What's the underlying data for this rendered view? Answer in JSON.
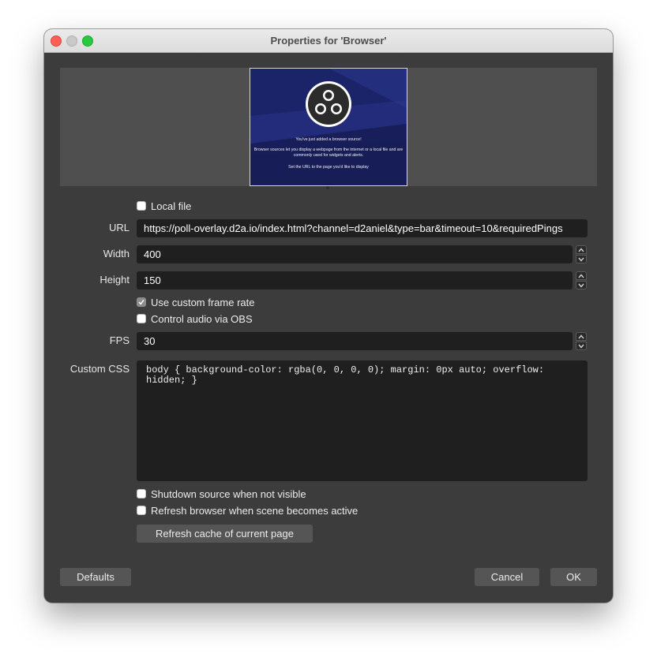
{
  "window": {
    "title": "Properties for 'Browser'"
  },
  "preview": {
    "line1": "You've just added a browser source!",
    "line2": "Browser sources let you display a webpage from the internet or a local file and are commonly used for widgets and alerts.",
    "line3": "Set the URL to the page you'd like to display"
  },
  "form": {
    "local_file": {
      "label": "Local file",
      "checked": false
    },
    "url": {
      "label": "URL",
      "value": "https://poll-overlay.d2a.io/index.html?channel=d2aniel&type=bar&timeout=10&requiredPings"
    },
    "width": {
      "label": "Width",
      "value": "400"
    },
    "height": {
      "label": "Height",
      "value": "150"
    },
    "custom_frame_rate": {
      "label": "Use custom frame rate",
      "checked": true
    },
    "control_audio": {
      "label": "Control audio via OBS",
      "checked": false
    },
    "fps": {
      "label": "FPS",
      "value": "30"
    },
    "custom_css": {
      "label": "Custom CSS",
      "value": "body { background-color: rgba(0, 0, 0, 0); margin: 0px auto; overflow:\nhidden; }"
    },
    "shutdown_source": {
      "label": "Shutdown source when not visible",
      "checked": false
    },
    "refresh_browser": {
      "label": "Refresh browser when scene becomes active",
      "checked": false
    },
    "refresh_cache_button": "Refresh cache of current page"
  },
  "buttons": {
    "defaults": "Defaults",
    "cancel": "Cancel",
    "ok": "OK"
  },
  "colors": {
    "window_bg": "#3c3c3c",
    "field_bg": "#1f1f1f",
    "preview_bg": "#4f4f4f",
    "button_bg": "#555555"
  }
}
